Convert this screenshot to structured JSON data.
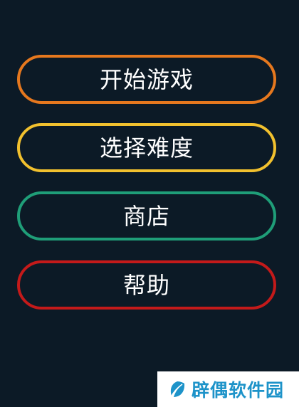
{
  "menu": {
    "buttons": [
      {
        "label": "开始游戏",
        "color": "#e6781e"
      },
      {
        "label": "选择难度",
        "color": "#f2c12e"
      },
      {
        "label": "商店",
        "color": "#1f9e78"
      },
      {
        "label": "帮助",
        "color": "#c41a1a"
      }
    ]
  },
  "watermark": {
    "text": "辟偶软件园",
    "color": "#1d93c9",
    "icon": "leaf-logo-icon"
  }
}
